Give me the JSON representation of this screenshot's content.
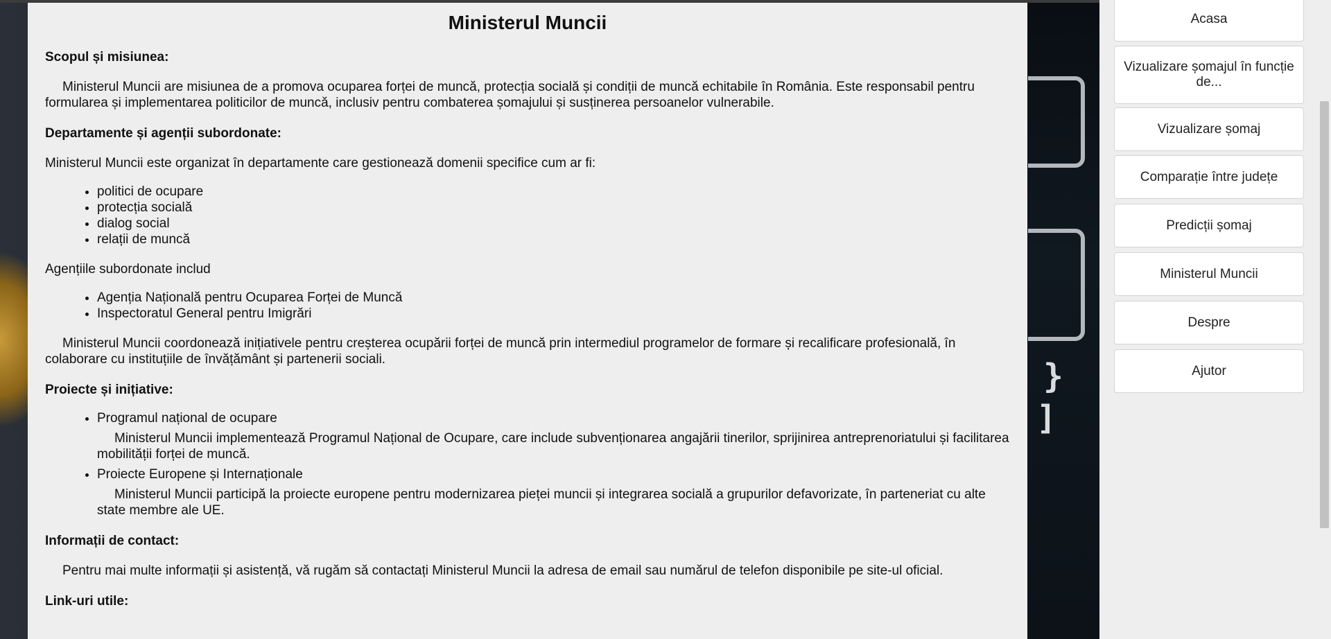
{
  "page": {
    "title": "Ministerul Muncii"
  },
  "content": {
    "scop_heading": "Scopul și misiunea:",
    "scop_text": "Ministerul Muncii are misiunea de a promova ocuparea forței de muncă, protecția socială și condiții de muncă echitabile în România. Este responsabil pentru formularea și implementarea politicilor de muncă, inclusiv pentru combaterea șomajului și susținerea persoanelor vulnerabile.",
    "dept_heading": "Departamente și agenții subordonate:",
    "dept_intro": "Ministerul Muncii este organizat în departamente care gestionează domenii specifice cum ar fi:",
    "dept_items": [
      "politici de ocupare",
      "protecția socială",
      "dialog social",
      "relații de muncă"
    ],
    "agentii_intro": "Agențiile subordonate includ",
    "agentii_items": [
      "Agenția Națională pentru Ocuparea Forței de Muncă",
      "Inspectoratul General pentru Imigrări"
    ],
    "coord_text": "Ministerul Muncii coordonează inițiativele pentru creșterea ocupării forței de muncă prin intermediul programelor de formare și recalificare profesională, în colaborare cu instituțiile de învățământ și partenerii sociali.",
    "proiecte_heading": "Proiecte și inițiative:",
    "proiecte": [
      {
        "title": "Programul național de ocupare",
        "desc": "Ministerul Muncii implementează Programul Național de Ocupare, care include subvenționarea angajării tinerilor, sprijinirea antreprenoriatului și facilitarea mobilității forței de muncă."
      },
      {
        "title": "Proiecte Europene și Internaționale",
        "desc": "Ministerul Muncii participă la proiecte europene pentru modernizarea pieței muncii și integrarea socială a grupurilor defavorizate, în parteneriat cu alte state membre ale UE."
      }
    ],
    "contact_heading": "Informații de contact:",
    "contact_text": "Pentru mai multe informații și asistență, vă rugăm să contactați Ministerul Muncii la adresa de email sau numărul de telefon disponibile pe site-ul oficial.",
    "links_heading": "Link-uri utile:"
  },
  "nav": {
    "items": [
      {
        "label": "Acasa"
      },
      {
        "label": "Vizualizare șomajul în funcție de..."
      },
      {
        "label": "Vizualizare șomaj"
      },
      {
        "label": "Comparație între județe"
      },
      {
        "label": "Predicții șomaj"
      },
      {
        "label": "Ministerul Muncii"
      },
      {
        "label": "Despre"
      },
      {
        "label": "Ajutor"
      }
    ]
  },
  "background": {
    "key_glyphs": [
      "}",
      "]"
    ]
  },
  "colors": {
    "panel": "#eeeeee",
    "button": "#ffffff",
    "border": "#d4d4d4"
  }
}
